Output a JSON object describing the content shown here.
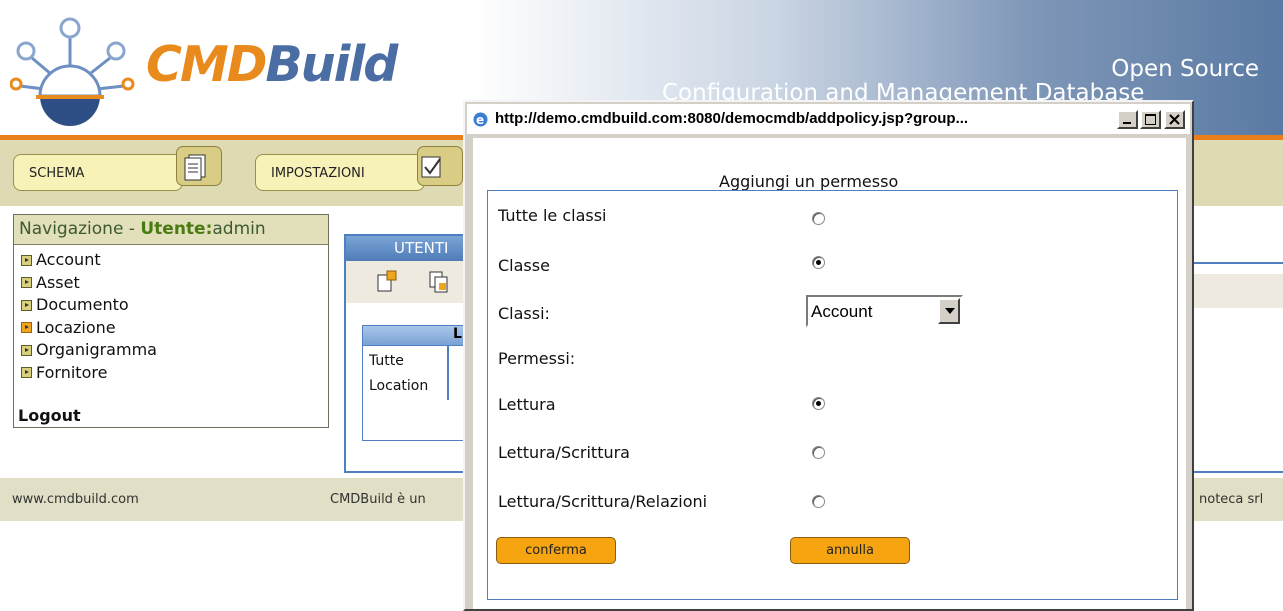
{
  "header": {
    "logo_cmd": "CMD",
    "logo_build": "Build",
    "tagline_line1": "Open Source",
    "tagline_line2": "Configuration and Management Database"
  },
  "tabs": [
    {
      "label": "SCHEMA",
      "icon": "schema-icon"
    },
    {
      "label": "IMPOSTAZIONI",
      "icon": "settings-icon"
    }
  ],
  "navigation": {
    "title_prefix": "Navigazione - ",
    "user_label": "Utente:",
    "user_name": "admin",
    "items": [
      {
        "label": "Account",
        "active": false
      },
      {
        "label": "Asset",
        "active": false
      },
      {
        "label": "Documento",
        "active": false
      },
      {
        "label": "Locazione",
        "active": true
      },
      {
        "label": "Organigramma",
        "active": false
      },
      {
        "label": "Fornitore",
        "active": false
      }
    ],
    "logout": "Logout"
  },
  "utenti_panel": {
    "title": "UTENTI",
    "column_header": "L",
    "rows": [
      "Tutte",
      "Location"
    ]
  },
  "footer": {
    "left": "www.cmdbuild.com",
    "middle": "CMDBuild è un",
    "right": "noteca srl"
  },
  "popup": {
    "url_title": "http://demo.cmdbuild.com:8080/democmdb/addpolicy.jsp?group...",
    "form_title": "Aggiungi un permesso",
    "scope_all_label": "Tutte le classi",
    "scope_all_selected": false,
    "scope_class_label": "Classe",
    "scope_class_selected": true,
    "classes_label": "Classi:",
    "classes_selected": "Account",
    "permissions_label": "Permessi:",
    "permissions": [
      {
        "label": "Lettura",
        "selected": true
      },
      {
        "label": "Lettura/Scrittura",
        "selected": false
      },
      {
        "label": "Lettura/Scrittura/Relazioni",
        "selected": false
      }
    ],
    "confirm_label": "conferma",
    "cancel_label": "annulla"
  },
  "colors": {
    "accent_orange": "#e97e1a",
    "brand_blue": "#4a6da3",
    "panel_blue": "#4e7fc0",
    "olive": "#dedbb4"
  }
}
